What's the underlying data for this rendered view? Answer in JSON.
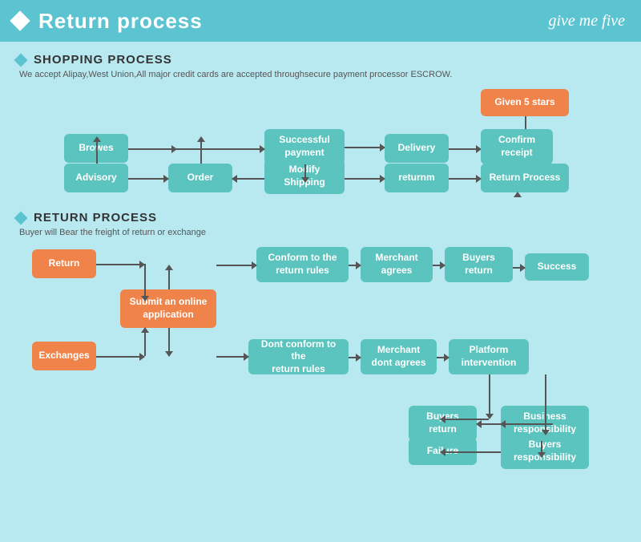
{
  "header": {
    "title": "Return process",
    "logo": "give me five"
  },
  "shopping": {
    "section_title": "SHOPPING PROCESS",
    "desc": "We accept Alipay,West Union,All major credit cards are accepted throughsecure payment processor ESCROW.",
    "boxes": {
      "browes": "Browes",
      "order": "Order",
      "advisory": "Advisory",
      "modify_shipping": "Modify\nShipping",
      "successful_payment": "Successful\npayment",
      "delivery": "Delivery",
      "confirm_receipt": "Confirm\nreceipt",
      "given_5_stars": "Given 5 stars",
      "returnm": "returnm",
      "return_process": "Return Process"
    }
  },
  "return": {
    "section_title": "RETURN PROCESS",
    "desc": "Buyer will Bear the freight of return or exchange",
    "boxes": {
      "return": "Return",
      "exchanges": "Exchanges",
      "submit_online": "Submit an online\napplication",
      "conform_return": "Conform to the\nreturn rules",
      "dont_conform": "Dont conform to the\nreturn rules",
      "merchant_agrees": "Merchant\nagrees",
      "merchant_dont": "Merchant\ndont agrees",
      "buyers_return1": "Buyers\nreturn",
      "buyers_return2": "Buyers\nreturn",
      "platform": "Platform\nintervention",
      "success": "Success",
      "failure": "Failure",
      "business_resp": "Business\nresponsibility",
      "buyers_resp": "Buyers\nresponsibility"
    }
  }
}
